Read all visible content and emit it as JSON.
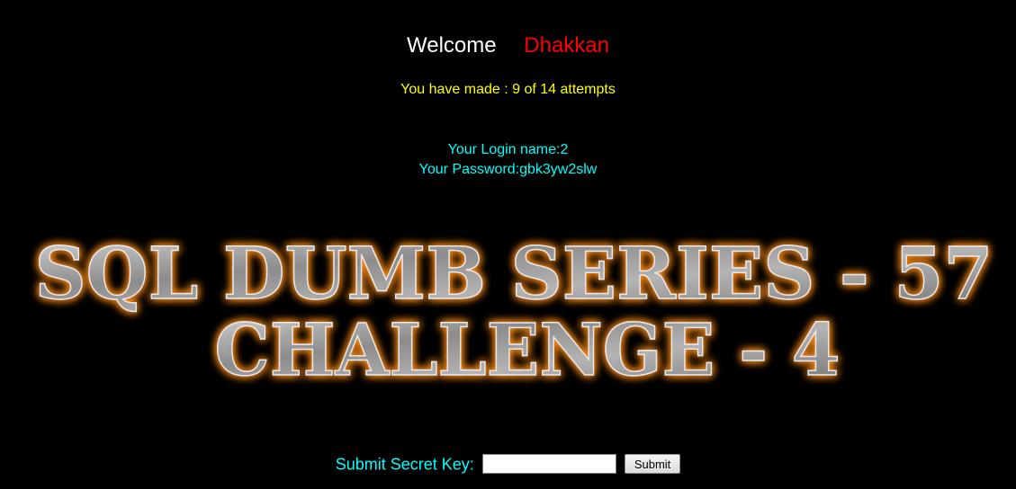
{
  "header": {
    "welcome_label": "Welcome",
    "username": "Dhakkan"
  },
  "attempts_text": "You have made : 9 of 14 attempts",
  "credentials": {
    "login_line": "Your Login name:2",
    "password_line": "Your Password:gbk3yw2slw"
  },
  "banner": {
    "line1": "SQL DUMB SERIES - 57",
    "line2": "CHALLENGE - 4"
  },
  "form": {
    "label": "Submit Secret Key:",
    "key_value": "",
    "submit_label": "Submit"
  },
  "colors": {
    "background": "#000000",
    "welcome": "#ffffff",
    "username": "#ff0000",
    "attempts": "#ffff00",
    "info": "#00ffff",
    "banner_fill": "#9a9a9a",
    "banner_glow": "#ff8c1a"
  }
}
